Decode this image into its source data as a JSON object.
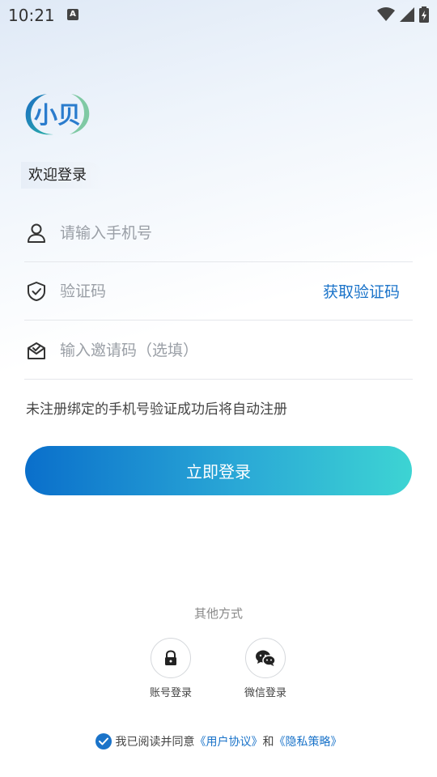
{
  "status_bar": {
    "time": "10:21",
    "notification_badge": "A"
  },
  "logo": {
    "text": "小贝"
  },
  "welcome": "欢迎登录",
  "form": {
    "phone_placeholder": "请输入手机号",
    "code_placeholder": "验证码",
    "get_code_label": "获取验证码",
    "invite_placeholder": "输入邀请码（选填）"
  },
  "hint": "未注册绑定的手机号验证成功后将自动注册",
  "login_button": "立即登录",
  "other": {
    "title": "其他方式",
    "account_label": "账号登录",
    "wechat_label": "微信登录"
  },
  "agreement": {
    "prefix": "我已阅读并同意",
    "user_agreement": "《用户协议》",
    "and": "和",
    "privacy_policy": "《隐私策略》"
  },
  "colors": {
    "accent": "#1a73c9",
    "gradient_start": "#0a6fcb",
    "gradient_end": "#3dd4d3"
  }
}
